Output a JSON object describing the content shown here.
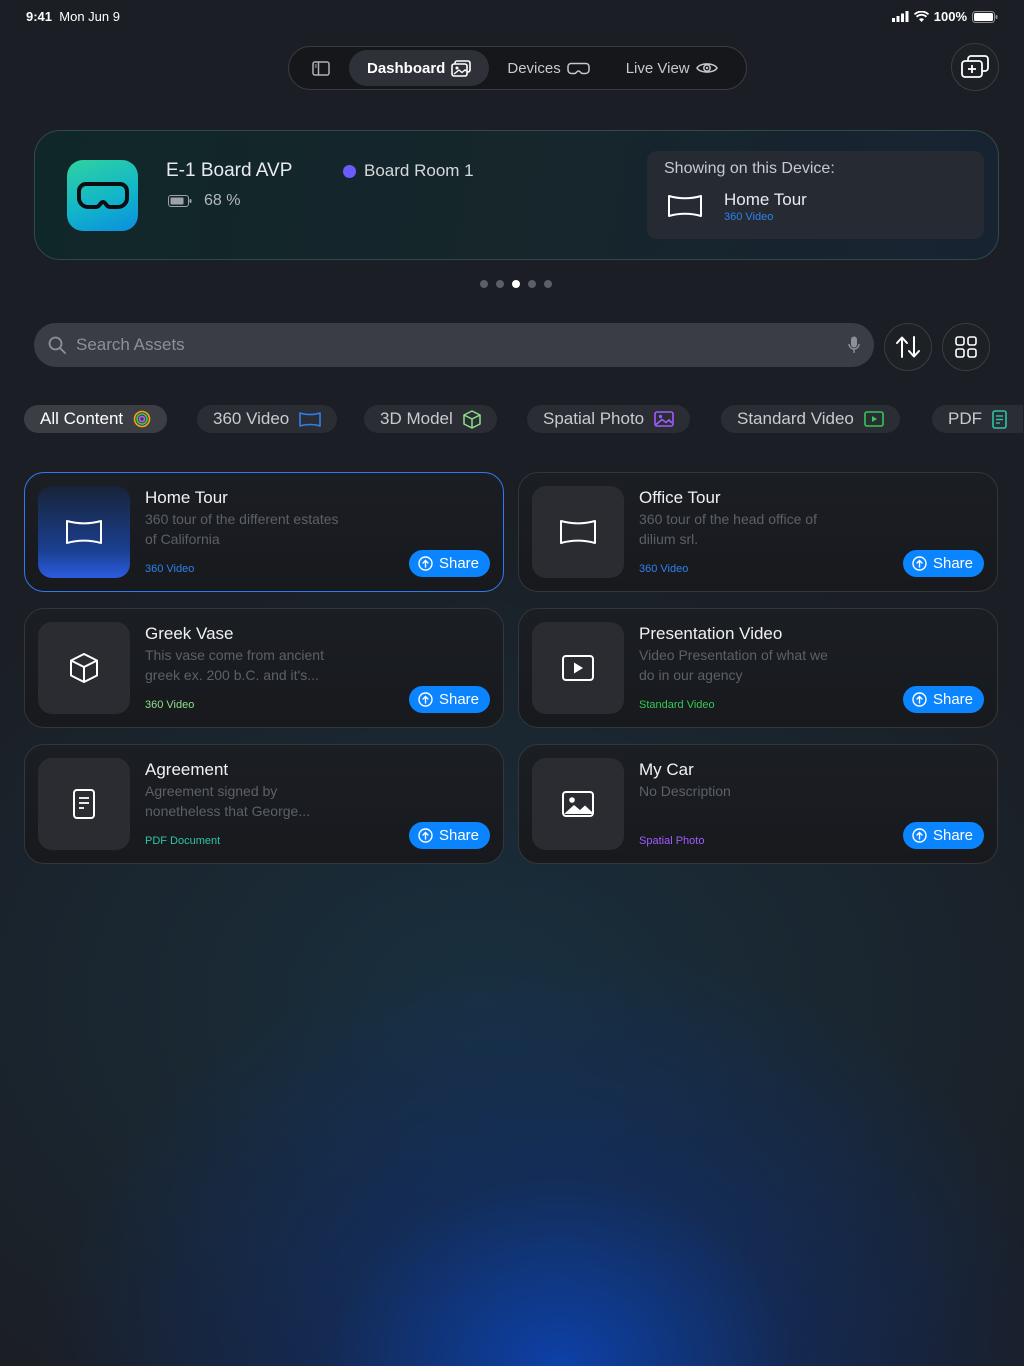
{
  "status_bar": {
    "time": "9:41",
    "date": "Mon Jun 9",
    "battery": "100%"
  },
  "nav": {
    "tabs": [
      {
        "label": "Dashboard",
        "icon": "dashboard-icon"
      },
      {
        "label": "Devices",
        "icon": "headset-icon"
      },
      {
        "label": "Live View",
        "icon": "eye-icon"
      }
    ],
    "active_tab": "Dashboard"
  },
  "device": {
    "name": "E-1 Board AVP",
    "battery": "68 %",
    "room": "Board Room 1",
    "showing_title": "Showing on this Device:",
    "showing_name": "Home Tour",
    "showing_type": "360 Video"
  },
  "pager": {
    "count": 5,
    "current": 3
  },
  "search": {
    "placeholder": "Search Assets"
  },
  "filters": [
    {
      "label": "All Content",
      "icon": "rings-icon"
    },
    {
      "label": "360 Video",
      "icon": "panorama-icon"
    },
    {
      "label": "3D Model",
      "icon": "cube-icon"
    },
    {
      "label": "Spatial Photo",
      "icon": "photo-icon"
    },
    {
      "label": "Standard Video",
      "icon": "play-icon"
    },
    {
      "label": "PDF",
      "icon": "document-icon"
    }
  ],
  "assets": [
    {
      "title": "Home Tour",
      "desc": "360 tour of the different estates of California",
      "type": "360 Video",
      "type_color": "#2f80ed",
      "share": "Share"
    },
    {
      "title": "Office Tour",
      "desc": "360 tour of the head office of dilium srl.",
      "type": "360 Video",
      "type_color": "#2f80ed",
      "share": "Share"
    },
    {
      "title": "Greek Vase",
      "desc": "This vase come from ancient greek ex. 200 b.C. and it's...",
      "type": "360 Video",
      "type_color": "#8fe08a",
      "share": "Share"
    },
    {
      "title": "Presentation Video",
      "desc": "Video Presentation of what we do in our agency",
      "type": "Standard Video",
      "type_color": "#34c759",
      "share": "Share"
    },
    {
      "title": "Agreement",
      "desc": "Agreement signed by nonetheless that George...",
      "type": "PDF Document",
      "type_color": "#2ec4a8",
      "share": "Share"
    },
    {
      "title": "My Car",
      "desc": "No Description",
      "type": "Spatial Photo",
      "type_color": "#a05cff",
      "share": "Share"
    }
  ]
}
